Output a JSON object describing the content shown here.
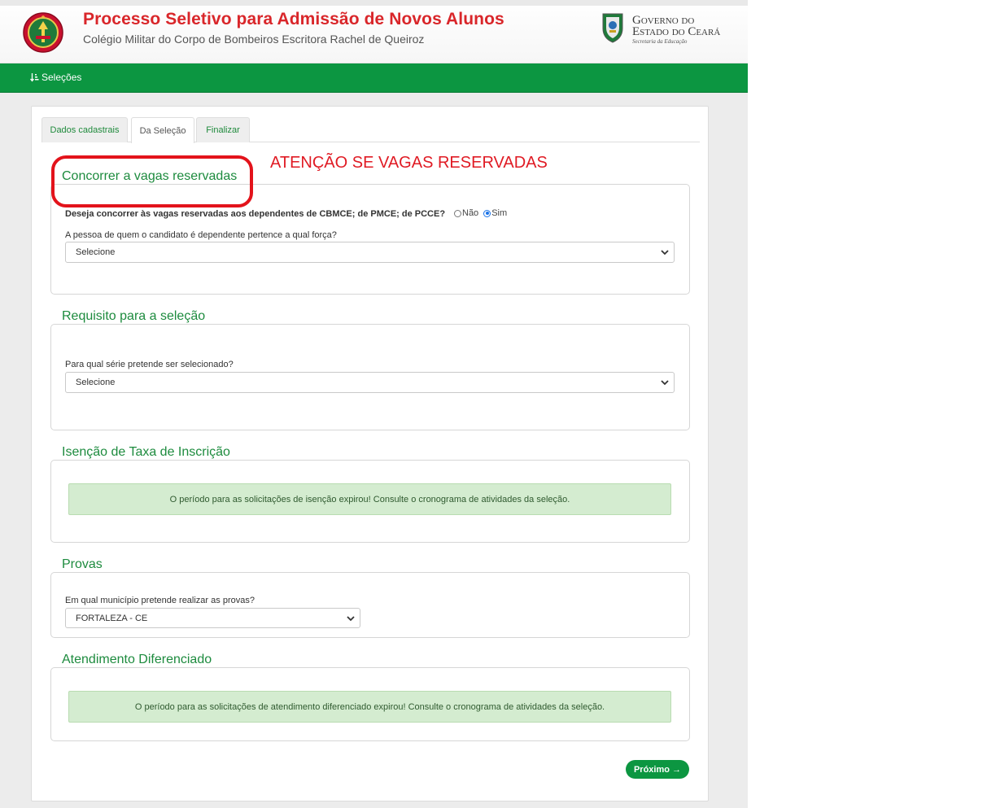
{
  "header": {
    "title": "Processo Seletivo para Admissão de Novos Alunos",
    "subtitle": "Colégio Militar do Corpo de Bombeiros Escritora Rachel de Queiroz",
    "gov_logo": {
      "line1": "Governo do",
      "line2": "Estado do Ceará",
      "line3": "Secretaria da Educação"
    }
  },
  "nav": {
    "items": [
      {
        "label": "Seleções",
        "icon": "sort-icon"
      }
    ]
  },
  "tabs": [
    {
      "label": "Dados cadastrais",
      "active": false
    },
    {
      "label": "Da Seleção",
      "active": true
    },
    {
      "label": "Finalizar",
      "active": false
    }
  ],
  "annotation": {
    "text": "ATENÇÃO SE VAGAS RESERVADAS"
  },
  "sections": {
    "vagas": {
      "legend": "Concorrer a vagas reservadas",
      "question": "Deseja concorrer às vagas reservadas aos dependentes de CBMCE; de PMCE; de PCCE?",
      "options": [
        {
          "label": "Não",
          "checked": false
        },
        {
          "label": "Sim",
          "checked": true
        }
      ],
      "force_label": "A pessoa de quem o candidato é dependente pertence a qual força?",
      "force_select": "Selecione"
    },
    "requisito": {
      "legend": "Requisito para a seleção",
      "serie_label": "Para qual série pretende ser selecionado?",
      "serie_select": "Selecione"
    },
    "isencao": {
      "legend": "Isenção de Taxa de Inscrição",
      "alert": "O período para as solicitações de isenção expirou! Consulte o cronograma de atividades da seleção."
    },
    "provas": {
      "legend": "Provas",
      "municipio_label": "Em qual município pretende realizar as provas?",
      "municipio_select": "FORTALEZA - CE"
    },
    "atendimento": {
      "legend": "Atendimento Diferenciado",
      "alert": "O período para as solicitações de atendimento diferenciado expirou! Consulte o cronograma de atividades da seleção."
    }
  },
  "next_button": {
    "label": "Próximo →"
  },
  "colors": {
    "brand_green": "#0c9641",
    "title_red": "#d9262a",
    "legend_green": "#1d8b3e",
    "annotation_red": "#e3131b",
    "alert_bg": "#d4ecd0"
  }
}
